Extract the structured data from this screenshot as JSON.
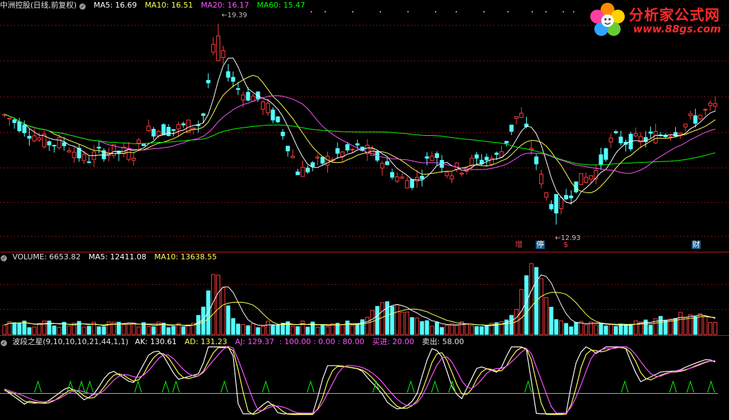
{
  "colors": {
    "up": "#ff3b3b",
    "down": "#54ffff",
    "ma5": "#ffffff",
    "ma10": "#ffff54",
    "ma20": "#ff54ff",
    "ma60": "#00ff00",
    "grid": "#8b1111",
    "bg": "#000000",
    "ak": "#ffffff",
    "ad": "#ffff54",
    "aj": "#ff54ff",
    "signal": "#00ff00"
  },
  "price_legend": {
    "title": "中洲控股(日线,前复权)",
    "icon": "settings-dot-icon",
    "ma5": "MA5: 16.69",
    "ma10": "MA10: 16.51",
    "ma20": "MA20: 16.17",
    "ma60": "MA60: 15.47"
  },
  "volume_legend": {
    "volume": "VOLUME: 6653.82",
    "ma5": "MA5: 12411.08",
    "ma10": "MA10: 13638.55"
  },
  "indicator_legend": {
    "name": "波段之星(9,10,10,10,21,44,1,1)",
    "ak": "AK: 130.61",
    "ad": "AD: 131.23",
    "aj": "AJ: 129.37",
    "levels": ": 100.00  : 0.00  : 80.00",
    "buy": "买进: 20.00",
    "sell": "卖出: 58.00"
  },
  "annotations": {
    "high_label": "19.39",
    "low_label": "12.93",
    "events": [
      {
        "text": "增",
        "color": "#ff3b3b"
      },
      {
        "text": "停",
        "color": "#54ffff"
      },
      {
        "text": "$",
        "color": "#ff3b3b"
      },
      {
        "text": "财",
        "color": "#54ffff"
      }
    ]
  },
  "watermark": {
    "title": "分析家公式网",
    "url": "www.88gs.com"
  },
  "chart_data": [
    {
      "type": "candlestick",
      "name": "price",
      "legend": [
        "MA5",
        "MA10",
        "MA20",
        "MA60"
      ],
      "ylim": [
        12.5,
        19.8
      ],
      "high": 19.39,
      "low": 12.93,
      "series": [
        {
          "name": "MA5",
          "values": [
            16.69
          ]
        },
        {
          "name": "MA10",
          "values": [
            16.51
          ]
        },
        {
          "name": "MA20",
          "values": [
            16.17
          ]
        },
        {
          "name": "MA60",
          "values": [
            15.47
          ]
        }
      ]
    },
    {
      "type": "bar",
      "name": "volume",
      "legend": [
        "VOLUME",
        "MA5",
        "MA10"
      ],
      "series": [
        {
          "name": "VOLUME",
          "values": [
            6653.82
          ]
        },
        {
          "name": "MA5",
          "values": [
            12411.08
          ]
        },
        {
          "name": "MA10",
          "values": [
            13638.55
          ]
        }
      ]
    },
    {
      "type": "line",
      "name": "indicator",
      "legend": [
        "AK",
        "AD",
        "AJ"
      ],
      "ylim": [
        0,
        100
      ],
      "series": [
        {
          "name": "AK",
          "values": [
            130.61
          ]
        },
        {
          "name": "AD",
          "values": [
            131.23
          ]
        },
        {
          "name": "AJ",
          "values": [
            129.37
          ]
        }
      ],
      "levels": [
        100,
        0,
        80,
        20,
        58
      ]
    }
  ]
}
